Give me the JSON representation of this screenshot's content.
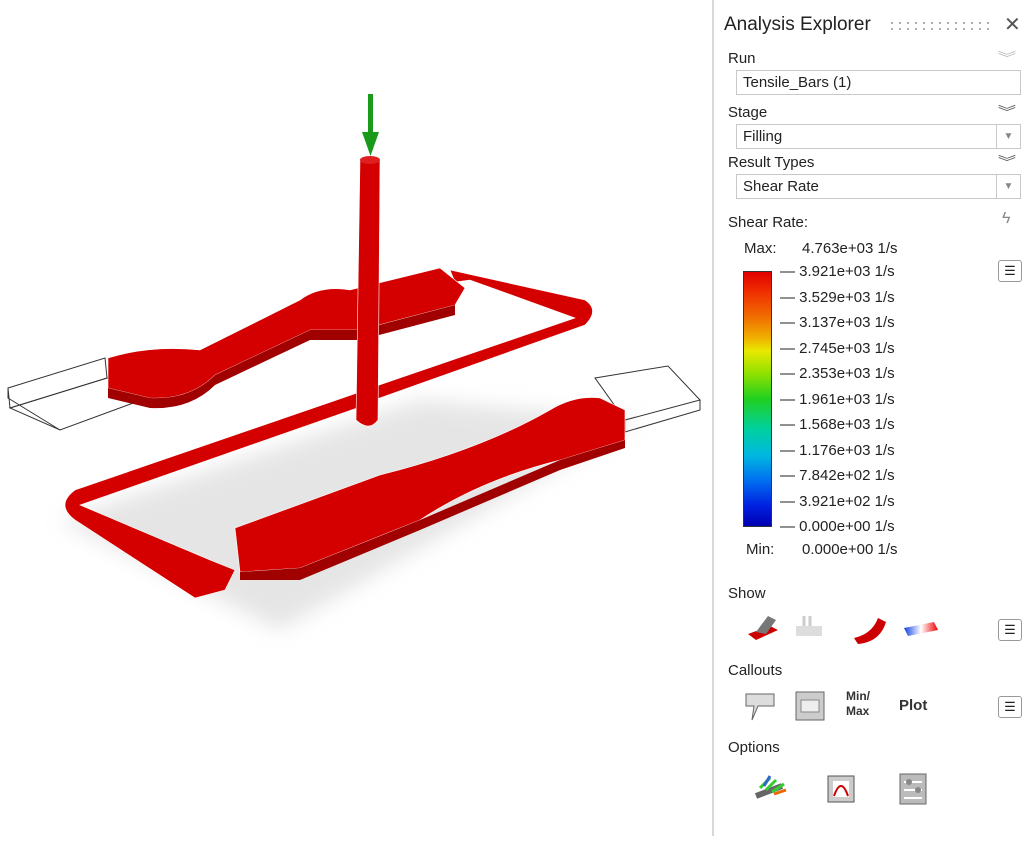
{
  "panel": {
    "title": "Analysis Explorer",
    "run": {
      "label": "Run",
      "value": "Tensile_Bars (1)"
    },
    "stage": {
      "label": "Stage",
      "value": "Filling"
    },
    "result_types": {
      "label": "Result Types",
      "value": "Shear Rate"
    },
    "legend": {
      "title": "Shear Rate:",
      "max_label": "Max:",
      "max_value": "4.763e+03 1/s",
      "min_label": "Min:",
      "min_value": "0.000e+00 1/s",
      "ticks": [
        "3.921e+03 1/s",
        "3.529e+03 1/s",
        "3.137e+03 1/s",
        "2.745e+03 1/s",
        "2.353e+03 1/s",
        "1.961e+03 1/s",
        "1.568e+03 1/s",
        "1.176e+03 1/s",
        "7.842e+02 1/s",
        "3.921e+02 1/s",
        "0.000e+00 1/s"
      ]
    },
    "show": {
      "label": "Show"
    },
    "callouts": {
      "label": "Callouts",
      "minmax": "Min/ Max",
      "plot": "Plot"
    },
    "options": {
      "label": "Options"
    }
  },
  "colors": {
    "part": "#d40000",
    "arrow": "#1a9a1a"
  }
}
